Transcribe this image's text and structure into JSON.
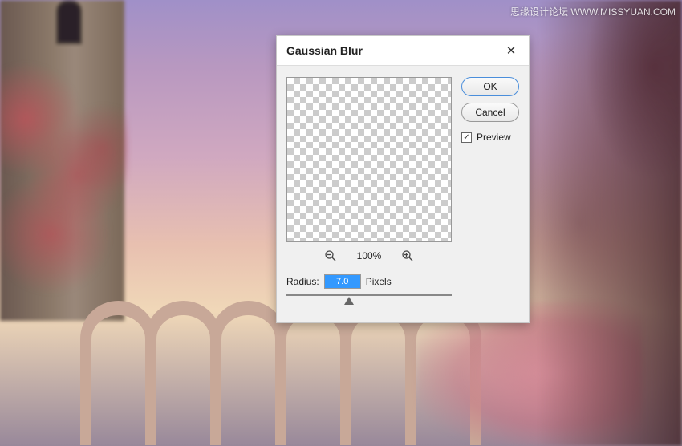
{
  "watermark": "思缘设计论坛 WWW.MISSYUAN.COM",
  "dialog": {
    "title": "Gaussian Blur",
    "close_symbol": "✕",
    "ok_label": "OK",
    "cancel_label": "Cancel",
    "preview_label": "Preview",
    "preview_checked": true,
    "zoom_level": "100%",
    "radius_label": "Radius:",
    "radius_value": "7.0",
    "radius_unit": "Pixels"
  }
}
